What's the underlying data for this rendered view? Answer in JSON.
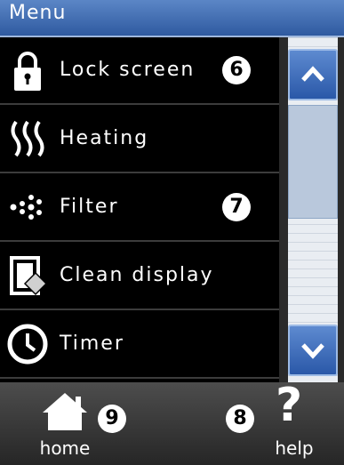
{
  "header": {
    "title": "Menu"
  },
  "menu": {
    "items": [
      {
        "label": "Lock screen",
        "icon": "lock-icon",
        "badge": "6"
      },
      {
        "label": "Heating",
        "icon": "heating-icon",
        "badge": ""
      },
      {
        "label": "Filter",
        "icon": "filter-icon",
        "badge": "7"
      },
      {
        "label": "Clean display",
        "icon": "clean-display-icon",
        "badge": ""
      },
      {
        "label": "Timer",
        "icon": "clock-icon",
        "badge": ""
      }
    ]
  },
  "scrollbar": {
    "up_icon": "chevron-up-icon",
    "down_icon": "chevron-down-icon"
  },
  "footer": {
    "home_label": "home",
    "home_badge": "9",
    "help_label": "help",
    "help_badge": "8",
    "help_glyph": "?"
  },
  "colors": {
    "header": "#3f6db5",
    "accent_blue": "#4a78c0",
    "background": "#000000",
    "footer": "#3a3a3a"
  }
}
